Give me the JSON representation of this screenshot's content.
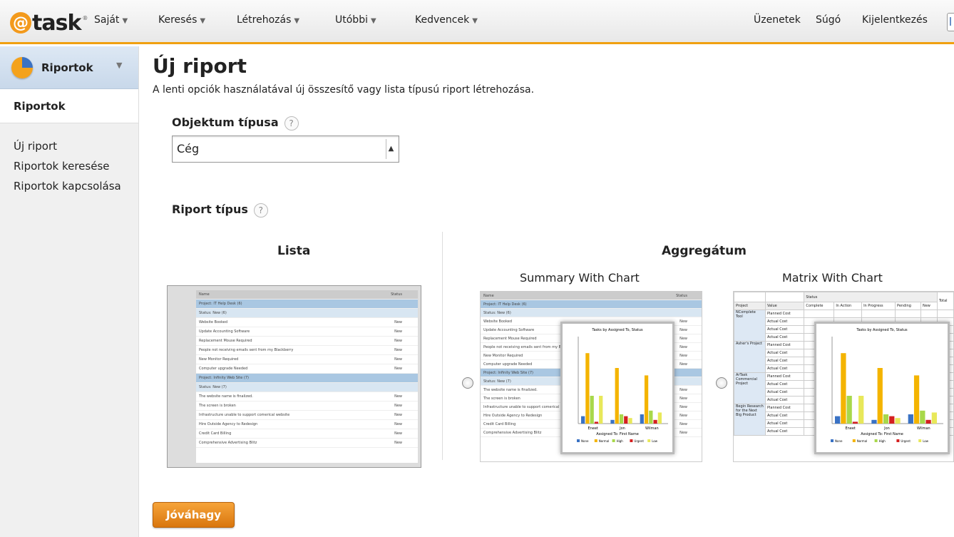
{
  "header": {
    "logo_text": "task",
    "logo_at": "@",
    "nav": [
      "Saját",
      "Keresés",
      "Létrehozás",
      "Utóbbi",
      "Kedvencek"
    ],
    "right": [
      "Üzenetek",
      "Súgó",
      "Kijelentkezés"
    ]
  },
  "sidebar": {
    "header_label": "Riportok",
    "section_label": "Riportok",
    "links": [
      "Új riport",
      "Riportok keresése",
      "Riportok kapcsolása"
    ]
  },
  "main": {
    "title": "Új riport",
    "subtitle": "A lenti opciók használatával új összesítő vagy lista típusú riport létrehozása.",
    "object_type_label": "Objektum típusa",
    "object_type_value": "Cég",
    "report_type_label": "Riport típus",
    "help_glyph": "?",
    "list_heading": "Lista",
    "aggregate_heading": "Aggregátum",
    "summary_heading": "Summary With Chart",
    "matrix_heading": "Matrix With Chart",
    "submit_label": "Jóváhagy"
  },
  "thumbnails": {
    "list_rows": [
      {
        "kind": "hd",
        "text": "Name",
        "status": "Status"
      },
      {
        "kind": "grp",
        "text": "Project: IT Help Desk (6)",
        "status": ""
      },
      {
        "kind": "sub",
        "text": "Status: New (6)",
        "status": ""
      },
      {
        "kind": "row",
        "text": "Website Booked",
        "status": "New"
      },
      {
        "kind": "row",
        "text": "Update Accounting Software",
        "status": "New"
      },
      {
        "kind": "row",
        "text": "Replacement Mouse Required",
        "status": "New"
      },
      {
        "kind": "row",
        "text": "People not receiving emails sent from my Blackberry",
        "status": "New"
      },
      {
        "kind": "row",
        "text": "New Monitor Required",
        "status": "New"
      },
      {
        "kind": "row",
        "text": "Computer upgrade Needed",
        "status": "New"
      },
      {
        "kind": "grp",
        "text": "Project: Infinity Web Site (7)",
        "status": ""
      },
      {
        "kind": "sub",
        "text": "Status: New (7)",
        "status": ""
      },
      {
        "kind": "row",
        "text": "The website name is finalized.",
        "status": "New"
      },
      {
        "kind": "row",
        "text": "The screen is broken",
        "status": "New"
      },
      {
        "kind": "row",
        "text": "Infrastructure unable to support comerical website",
        "status": "New"
      },
      {
        "kind": "row",
        "text": "Hire Outside Agency to Redesign",
        "status": "New"
      },
      {
        "kind": "row",
        "text": "Credit Card Billing",
        "status": "New"
      },
      {
        "kind": "row",
        "text": "Comprehensive Advertising Blitz",
        "status": "New"
      }
    ],
    "chart_title": "Tasks by Assigned To, Status",
    "chart_xlabel": "Assigned To: First Name",
    "chart_groups": [
      "Eneet",
      "Jon",
      "Wilman"
    ],
    "legend": [
      "None",
      "Normal",
      "High",
      "Urgent",
      "Low"
    ],
    "matrix_projects": [
      "NComplete Tool",
      "Asher's Project",
      "ArTask Commercial Project",
      "Begin Research for the Next Big Product"
    ]
  }
}
